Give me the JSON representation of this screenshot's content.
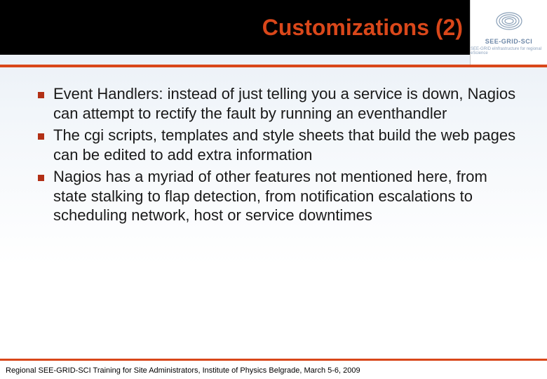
{
  "header": {
    "title": "Customizations (2)"
  },
  "logo": {
    "name": "SEE-GRID-SCI",
    "subtitle": "SEE-GRID eInfrastructure for regional eScience"
  },
  "bullets": [
    "Event Handlers: instead of just telling you a service is down, Nagios can attempt to rectify the fault by running an eventhandler",
    "The cgi scripts, templates and style sheets that build the web pages can be edited to add extra information",
    "Nagios has a myriad of other features not mentioned here, from state stalking to flap detection, from notification escalations to scheduling network, host or service downtimes"
  ],
  "footer": {
    "text": "Regional SEE-GRID-SCI Training for Site Administrators, Institute of Physics Belgrade, March 5-6, 2009"
  }
}
